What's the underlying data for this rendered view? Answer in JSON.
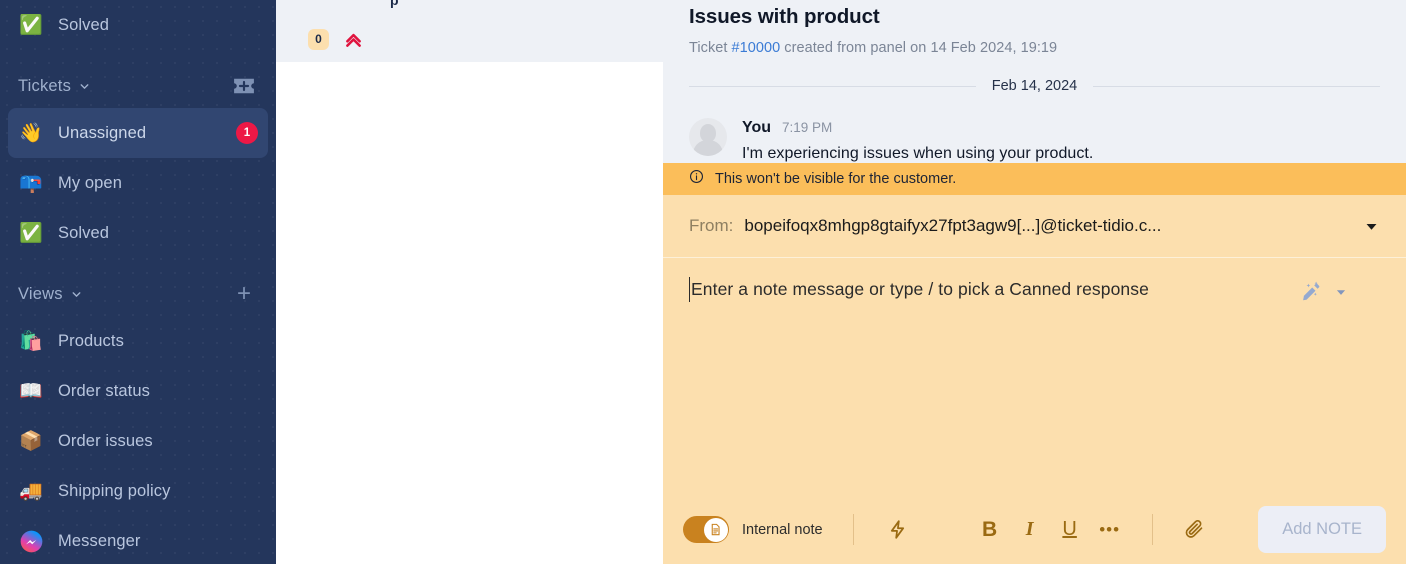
{
  "sidebar": {
    "top_item": {
      "icon": "✅",
      "label": "Solved"
    },
    "tickets_section": {
      "title": "Tickets",
      "add_icon": "add-ticket-icon"
    },
    "tickets_items": [
      {
        "icon": "👋",
        "label": "Unassigned",
        "badge": "1",
        "active": true
      },
      {
        "icon": "📪",
        "label": "My open",
        "badge": "",
        "active": false
      },
      {
        "icon": "✅",
        "label": "Solved",
        "badge": "",
        "active": false
      }
    ],
    "views_section": {
      "title": "Views",
      "add_icon": "plus-icon"
    },
    "views_items": [
      {
        "icon": "🛍️",
        "label": "Products"
      },
      {
        "icon": "📖",
        "label": "Order status"
      },
      {
        "icon": "📦",
        "label": "Order issues"
      },
      {
        "icon": "🚚",
        "label": "Shipping policy"
      },
      {
        "icon": "💬",
        "label": "Messenger"
      }
    ]
  },
  "list_panel": {
    "card": {
      "clipped_text": "p",
      "count_badge": "0",
      "priority_icon": "priority-urgent-icon"
    }
  },
  "ticket": {
    "title": "Issues with product",
    "meta_prefix": "Ticket ",
    "meta_id": "#10000",
    "meta_suffix": " created from panel on 14 Feb 2024, 19:19",
    "date_separator": "Feb 14, 2024",
    "message": {
      "author": "You",
      "time": "7:19 PM",
      "text": "I'm experiencing issues when using your product."
    },
    "notice": "This won't be visible for the customer.",
    "from": {
      "label": "From:",
      "value": "bopeifoqx8mhgp8gtaifyx27fpt3agw9[...]@ticket-tidio.c...",
      "caret": "chevron-down-icon"
    },
    "composer": {
      "placeholder": "Enter a note message or type / to pick a Canned response",
      "ai_icon": "magic-wand-icon",
      "ai_caret": "chevron-down-icon"
    },
    "toolbar": {
      "toggle_label": "Internal note",
      "toggle_on": true,
      "shortcut_icon": "lightning-icon",
      "bold_label": "B",
      "italic_label": "I",
      "underline_label": "U",
      "more_label": "•••",
      "attach_icon": "paperclip-icon",
      "submit_label": "Add NOTE"
    }
  },
  "colors": {
    "sidebar_bg": "#24365c",
    "sidebar_active": "#314671",
    "badge_red": "#ed1846",
    "panel_bg": "#eef1f6",
    "notice_amber": "#fbbe5a",
    "composer_amber": "#fcdfae",
    "link_blue": "#3a7bd5",
    "toggle_on": "#c9821f",
    "toolbar_icon": "#9a6a12"
  }
}
